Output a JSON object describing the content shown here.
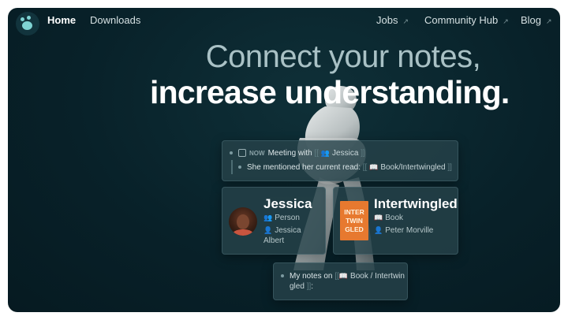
{
  "nav": {
    "left": [
      {
        "label": "Home",
        "active": true
      },
      {
        "label": "Downloads",
        "active": false
      }
    ],
    "right": [
      {
        "label": "Jobs"
      },
      {
        "label": "Community Hub"
      },
      {
        "label": "Blog"
      }
    ],
    "external_icon": "↗"
  },
  "hero": {
    "line1": "Connect your notes,",
    "line2": "increase understanding."
  },
  "journal": {
    "now_label": "NOW",
    "line1_text": "Meeting with",
    "line1_ref": "Jessica",
    "line2_text": "She mentioned her current read:",
    "line2_ref": "Book/Intertwingled",
    "bracket_open": "[[",
    "bracket_close": "]]"
  },
  "person_card": {
    "title": "Jessica",
    "type": "Person",
    "name_line1": "Jessica",
    "name_line2": "Albert"
  },
  "book_card": {
    "title": "Intertwingled",
    "type": "Book",
    "author": "Peter Morville",
    "cover_lines": [
      "INTER",
      "TWIN",
      "GLED"
    ]
  },
  "notes_card": {
    "text": "My notes on",
    "ref_line1": "Book / Intertwin",
    "ref_line2": "gled",
    "suffix": ":"
  },
  "icons": {
    "people": "👥",
    "book": "📖",
    "person": "👤"
  },
  "colors": {
    "background": "#082129",
    "accent": "#7fd3d3",
    "card": "#264249",
    "book_cover": "#e7792f"
  }
}
